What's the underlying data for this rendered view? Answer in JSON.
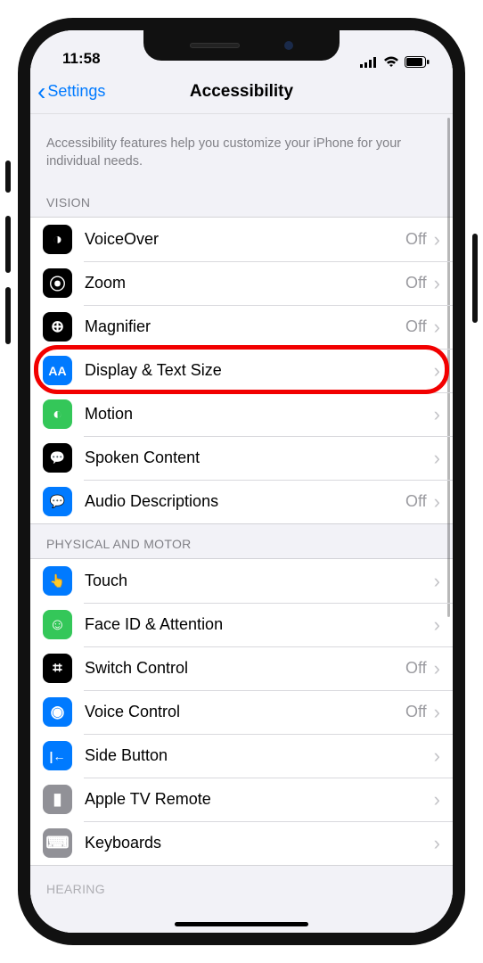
{
  "status": {
    "time": "11:58"
  },
  "nav": {
    "back_label": "Settings",
    "title": "Accessibility"
  },
  "intro": "Accessibility features help you customize your iPhone for your individual needs.",
  "sections": {
    "vision": {
      "header": "VISION",
      "items": [
        {
          "label": "VoiceOver",
          "value": "Off",
          "icon": "voiceover-icon",
          "bg": "#000000",
          "glyph": "◑"
        },
        {
          "label": "Zoom",
          "value": "Off",
          "icon": "zoom-icon",
          "bg": "#000000",
          "glyph": "⦿"
        },
        {
          "label": "Magnifier",
          "value": "Off",
          "icon": "magnifier-icon",
          "bg": "#000000",
          "glyph": "⊕"
        },
        {
          "label": "Display & Text Size",
          "value": "",
          "icon": "text-size-icon",
          "bg": "#007aff",
          "glyph": "AA"
        },
        {
          "label": "Motion",
          "value": "",
          "icon": "motion-icon",
          "bg": "#34c759",
          "glyph": "◐"
        },
        {
          "label": "Spoken Content",
          "value": "",
          "icon": "spoken-content-icon",
          "bg": "#000000",
          "glyph": "💬"
        },
        {
          "label": "Audio Descriptions",
          "value": "Off",
          "icon": "audio-descriptions-icon",
          "bg": "#007aff",
          "glyph": "💬"
        }
      ]
    },
    "physical": {
      "header": "PHYSICAL AND MOTOR",
      "items": [
        {
          "label": "Touch",
          "value": "",
          "icon": "touch-icon",
          "bg": "#007aff",
          "glyph": "👆"
        },
        {
          "label": "Face ID & Attention",
          "value": "",
          "icon": "faceid-icon",
          "bg": "#34c759",
          "glyph": "☺"
        },
        {
          "label": "Switch Control",
          "value": "Off",
          "icon": "switch-control-icon",
          "bg": "#000000",
          "glyph": "⌗"
        },
        {
          "label": "Voice Control",
          "value": "Off",
          "icon": "voice-control-icon",
          "bg": "#007aff",
          "glyph": "◉"
        },
        {
          "label": "Side Button",
          "value": "",
          "icon": "side-button-icon",
          "bg": "#007aff",
          "glyph": "|←"
        },
        {
          "label": "Apple TV Remote",
          "value": "",
          "icon": "apple-tv-remote-icon",
          "bg": "#919197",
          "glyph": "▮"
        },
        {
          "label": "Keyboards",
          "value": "",
          "icon": "keyboards-icon",
          "bg": "#919197",
          "glyph": "⌨"
        }
      ]
    },
    "hearing": {
      "header": "HEARING"
    }
  },
  "highlight_index": 3
}
